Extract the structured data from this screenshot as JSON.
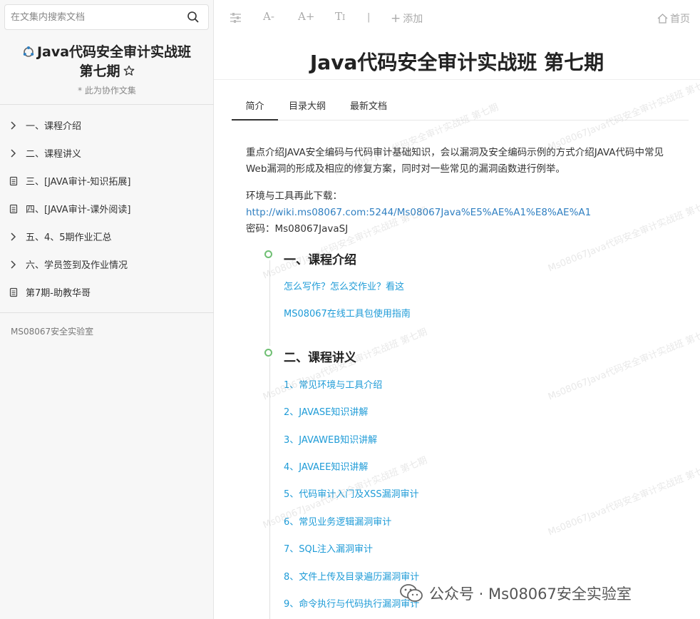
{
  "search": {
    "placeholder": "在文集内搜索文档"
  },
  "sidebar": {
    "title_line1": "Java代码安全审计实战班",
    "title_line2": "第七期",
    "subtitle": "* 此为协作文集",
    "items": [
      {
        "label": "一、课程介绍",
        "icon": "chevron-right-icon"
      },
      {
        "label": "二、课程讲义",
        "icon": "chevron-right-icon"
      },
      {
        "label": "三、[JAVA审计-知识拓展]",
        "icon": "document-icon"
      },
      {
        "label": "四、[JAVA审计-课外阅读]",
        "icon": "document-icon"
      },
      {
        "label": "五、4、5期作业汇总",
        "icon": "chevron-right-icon"
      },
      {
        "label": "六、学员签到及作业情况",
        "icon": "chevron-right-icon"
      },
      {
        "label": "第7期-助教华哥",
        "icon": "document-icon"
      }
    ],
    "footer": "MS08067安全实验室"
  },
  "toolbar": {
    "font_smaller": "A-",
    "font_larger": "A+",
    "font_type": "T",
    "separator": "|",
    "add_label": "添加",
    "home_label": "首页"
  },
  "main": {
    "title": "Java代码安全审计实战班 第七期",
    "tabs": [
      {
        "label": "简介",
        "active": true
      },
      {
        "label": "目录大纲",
        "active": false
      },
      {
        "label": "最新文档",
        "active": false
      }
    ],
    "description": "重点介绍JAVA安全编码与代码审计基础知识，会以漏洞及安全编码示例的方式介绍JAVA代码中常见Web漏洞的形成及相应的修复方案，同时对一些常见的漏洞函数进行例举。",
    "env_label": "环境与工具再此下载：",
    "env_link": "http://wiki.ms08067.com:5244/Ms08067Java%E5%AE%A1%E8%AE%A1",
    "password": "密码：Ms08067JavaSJ",
    "sections": [
      {
        "title": "一、课程介绍",
        "links": [
          "怎么写作？怎么交作业？看这",
          "MS08067在线工具包使用指南"
        ]
      },
      {
        "title": "二、课程讲义",
        "links": [
          "1、常见环境与工具介绍",
          "2、JAVASE知识讲解",
          "3、JAVAWEB知识讲解",
          "4、JAVAEE知识讲解",
          "5、代码审计入门及XSS漏洞审计",
          "6、常见业务逻辑漏洞审计",
          "7、SQL注入漏洞审计",
          "8、文件上传及目录遍历漏洞审计",
          "9、命令执行与代码执行漏洞审计"
        ]
      }
    ]
  },
  "watermark": "Ms08067Java代码安全审计实战班 第七期",
  "brand": "公众号 · Ms08067安全实验室",
  "colors": {
    "link": "#1e9bd7",
    "timeline_circle": "#6fbf73",
    "sidebar_bg": "#f7f7f7"
  }
}
